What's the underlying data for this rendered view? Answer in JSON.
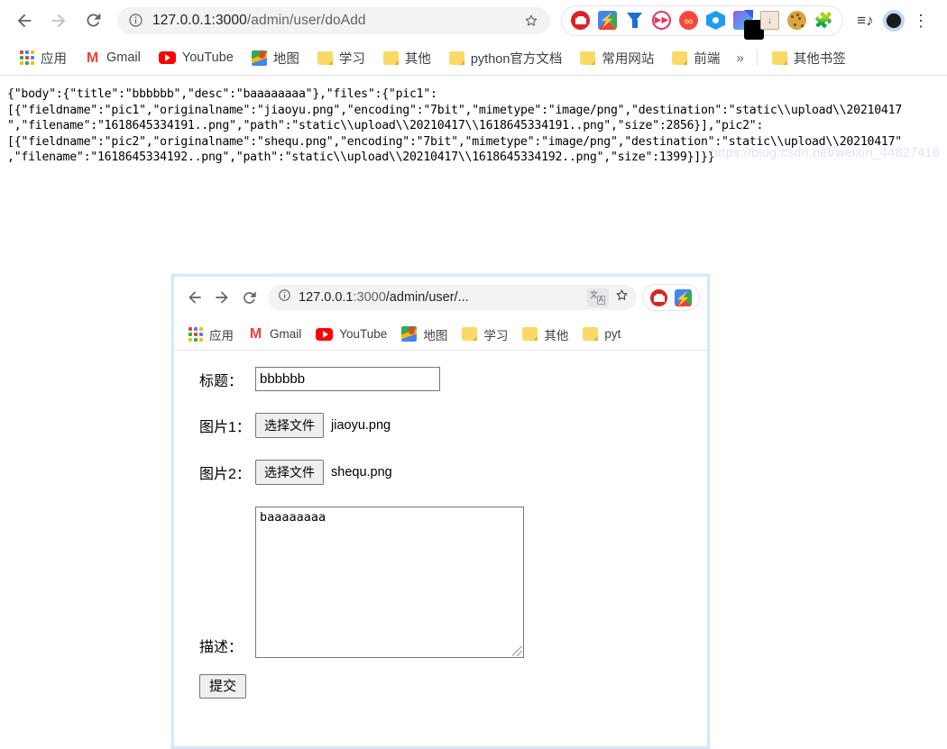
{
  "browser": {
    "back_label": "Back",
    "forward_label": "Forward",
    "reload_label": "Reload",
    "url_main": "127.0.0.1:3000",
    "url_path": "/admin/user/doAdd",
    "bookmark_star_label": "Bookmark this tab",
    "extensions": [
      {
        "name": "ublock-origin-icon"
      },
      {
        "name": "flash-icon"
      },
      {
        "name": "vflow-icon"
      },
      {
        "name": "fast-forward-icon"
      },
      {
        "name": "infinity-icon"
      },
      {
        "name": "hexagon-icon"
      },
      {
        "name": "magic-wand-icon"
      },
      {
        "name": "folder-download-icon"
      },
      {
        "name": "cookie-icon"
      },
      {
        "name": "puzzle-icon"
      }
    ],
    "playlist_icon": "playlist-icon",
    "profile_icon": "profile-avatar-icon",
    "menu_icon": "kebab-menu-icon"
  },
  "bookmarks": {
    "items": [
      {
        "label": "应用",
        "icon": "apps-grid-icon"
      },
      {
        "label": "Gmail",
        "icon": "gmail-icon"
      },
      {
        "label": "YouTube",
        "icon": "youtube-icon"
      },
      {
        "label": "地图",
        "icon": "google-maps-icon"
      },
      {
        "label": "学习",
        "icon": "folder-icon"
      },
      {
        "label": "其他",
        "icon": "folder-icon"
      },
      {
        "label": "python官方文档",
        "icon": "folder-icon"
      },
      {
        "label": "常用网站",
        "icon": "folder-icon"
      },
      {
        "label": "前端",
        "icon": "folder-icon"
      }
    ],
    "overflow_label": "»",
    "other_bookmarks": {
      "label": "其他书签",
      "icon": "folder-icon"
    }
  },
  "page": {
    "json_response": "{\"body\":{\"title\":\"bbbbbb\",\"desc\":\"baaaaaaaa\"},\"files\":{\"pic1\":\n[{\"fieldname\":\"pic1\",\"originalname\":\"jiaoyu.png\",\"encoding\":\"7bit\",\"mimetype\":\"image/png\",\"destination\":\"static\\\\upload\\\\20210417\n\",\"filename\":\"1618645334191..png\",\"path\":\"static\\\\upload\\\\20210417\\\\1618645334191..png\",\"size\":2856}],\"pic2\":\n[{\"fieldname\":\"pic2\",\"originalname\":\"shequ.png\",\"encoding\":\"7bit\",\"mimetype\":\"image/png\",\"destination\":\"static\\\\upload\\\\20210417\"\n,\"filename\":\"1618645334192..png\",\"path\":\"static\\\\upload\\\\20210417\\\\1618645334192..png\",\"size\":1399}]}}"
  },
  "screenshot": {
    "browser": {
      "url_main": "127.0.0.1",
      "url_port": ":3000",
      "url_path": "/admin/user/...",
      "translate_icon": "translate-icon",
      "star_icon": "bookmark-star-icon",
      "extensions": [
        {
          "name": "ublock-origin-icon"
        },
        {
          "name": "flash-icon"
        }
      ]
    },
    "bookmarks": {
      "items": [
        {
          "label": "应用",
          "icon": "apps-grid-icon"
        },
        {
          "label": "Gmail",
          "icon": "gmail-icon"
        },
        {
          "label": "YouTube",
          "icon": "youtube-icon"
        },
        {
          "label": "地图",
          "icon": "google-maps-icon"
        },
        {
          "label": "学习",
          "icon": "folder-icon"
        },
        {
          "label": "其他",
          "icon": "folder-icon"
        },
        {
          "label": "pyt",
          "icon": "folder-icon"
        }
      ]
    },
    "form": {
      "title_label": "标题：",
      "title_value": "bbbbbb",
      "title_placeholder": "",
      "pic1_label": "图片1：",
      "pic1_button": "选择文件",
      "pic1_filename": "jiaoyu.png",
      "pic2_label": "图片2：",
      "pic2_button": "选择文件",
      "pic2_filename": "shequ.png",
      "desc_label": "描述：",
      "desc_value": "baaaaaaaa",
      "submit_label": "提交"
    }
  },
  "watermark": "https://blog.csdn.net/weixin_44827418"
}
